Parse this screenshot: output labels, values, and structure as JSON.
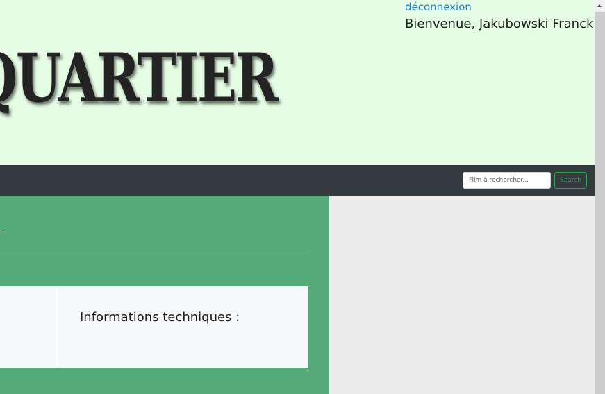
{
  "header": {
    "logo_text": "QUARTIER",
    "logout_label": "déconnexion",
    "welcome_text": "Bienvenue, Jakubowski Franck"
  },
  "navbar": {
    "search_placeholder": "Film à rechercher...",
    "search_value": "",
    "search_button_label": "Search"
  },
  "main": {
    "tech_info_heading": "Informations techniques :"
  },
  "colors": {
    "header_bg": "#e4fde4",
    "navbar_bg": "#343a40",
    "main_green": "#56ab7b",
    "search_accent": "#28a745",
    "link_blue": "#1a7fe0"
  }
}
